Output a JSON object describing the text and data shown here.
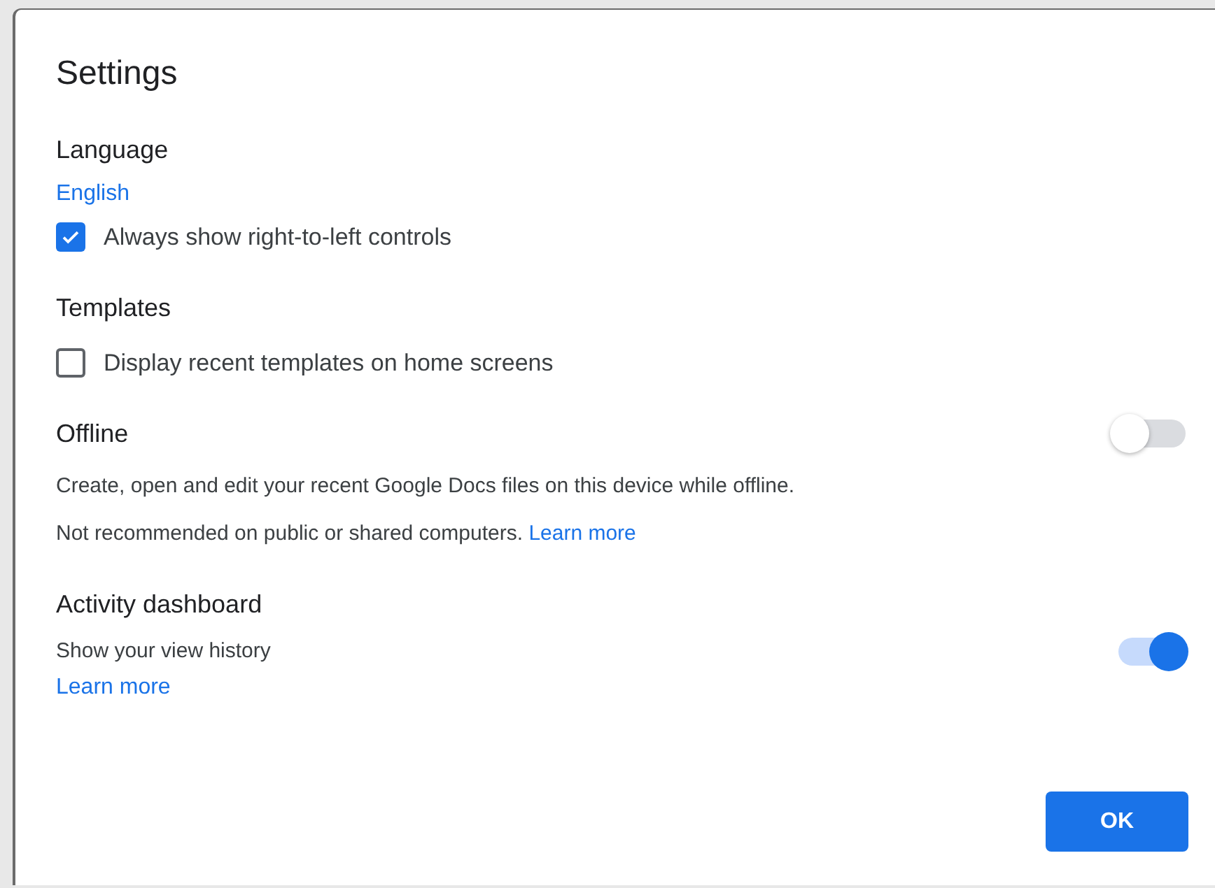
{
  "dialog": {
    "title": "Settings"
  },
  "sections": [
    {
      "heading": "Language",
      "items": [
        {
          "kind": "link",
          "text": "English"
        },
        {
          "kind": "checkbox",
          "label": "Always show right-to-left controls",
          "checked": true
        }
      ]
    },
    {
      "heading": "Templates",
      "items": [
        {
          "kind": "checkbox",
          "label": "Display recent templates on home screens",
          "checked": false
        }
      ]
    },
    {
      "heading": "Offline",
      "toggle": {
        "on": false
      },
      "items": [
        {
          "kind": "text",
          "text": "Create, open and edit your recent Google Docs files on this device while offline."
        },
        {
          "kind": "text",
          "text": "Not recommended on public or shared computers.",
          "link": "Learn more"
        }
      ]
    },
    {
      "heading": "Activity dashboard",
      "items": [
        {
          "kind": "text",
          "text": "Show your view history",
          "toggle": {
            "on": true
          }
        },
        {
          "kind": "link",
          "text": "Learn more"
        }
      ]
    }
  ],
  "buttons": [
    "OK"
  ]
}
